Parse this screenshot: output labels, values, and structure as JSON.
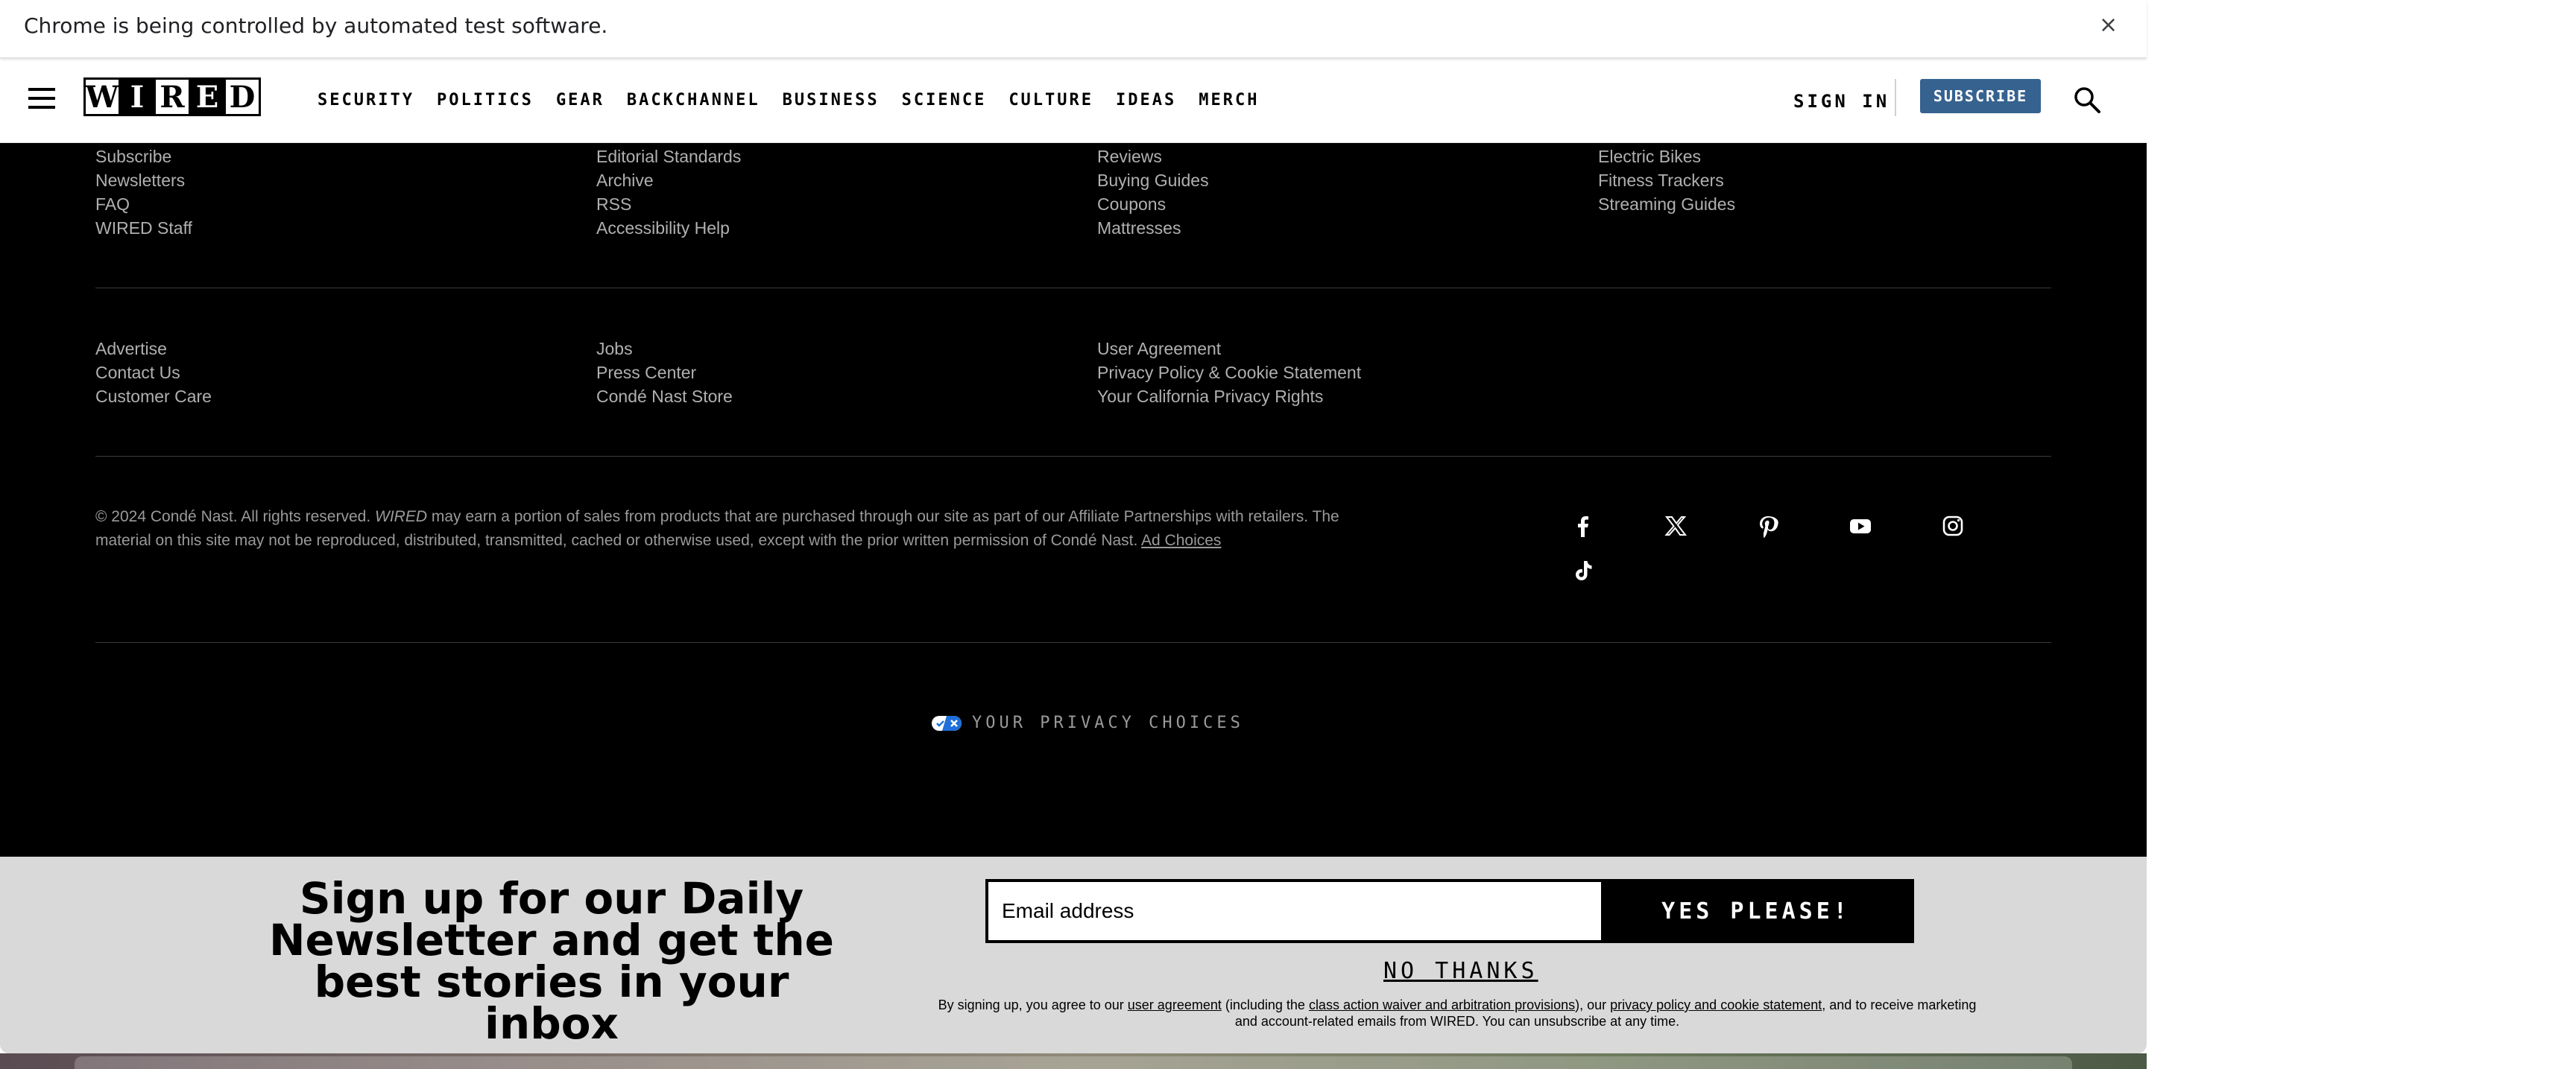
{
  "chrome_banner": {
    "text": "Chrome is being controlled by automated test software.",
    "close": "×"
  },
  "header": {
    "logo_letters": [
      "W",
      "I",
      "R",
      "E",
      "D"
    ],
    "nav": [
      "SECURITY",
      "POLITICS",
      "GEAR",
      "BACKCHANNEL",
      "BUSINESS",
      "SCIENCE",
      "CULTURE",
      "IDEAS",
      "MERCH"
    ],
    "sign_in": "SIGN IN",
    "subscribe": "SUBSCRIBE"
  },
  "footer": {
    "top_col1": [
      "Subscribe",
      "Newsletters",
      "FAQ",
      "WIRED Staff"
    ],
    "top_col2": [
      "Editorial Standards",
      "Archive",
      "RSS",
      "Accessibility Help"
    ],
    "top_col3": [
      "Reviews",
      "Buying Guides",
      "Coupons",
      "Mattresses"
    ],
    "top_col4": [
      "Electric Bikes",
      "Fitness Trackers",
      "Streaming Guides"
    ],
    "mid_col1": [
      "Advertise",
      "Contact Us",
      "Customer Care"
    ],
    "mid_col2": [
      "Jobs",
      "Press Center",
      "Condé Nast Store"
    ],
    "mid_col3": [
      "User Agreement",
      "Privacy Policy & Cookie Statement",
      "Your California Privacy Rights"
    ],
    "legal_prefix": "© 2024 Condé Nast. All rights reserved. ",
    "legal_brand": "WIRED",
    "legal_body": " may earn a portion of sales from products that are purchased through our site as part of our Affiliate Partnerships with retailers. The material on this site may not be reproduced, distributed, transmitted, cached or otherwise used, except with the prior written permission of Condé Nast. ",
    "ad_choices": "Ad Choices",
    "social_icons": [
      "facebook-icon",
      "x-icon",
      "pinterest-icon",
      "youtube-icon",
      "instagram-icon",
      "tiktok-icon"
    ],
    "privacy_choices": "YOUR PRIVACY CHOICES"
  },
  "newsletter": {
    "heading": "Sign up for our Daily Newsletter and get the best stories in your inbox",
    "email_placeholder": "Email address",
    "submit": "YES PLEASE!",
    "no_thanks": "NO THANKS",
    "disclaimer_1": "By signing up, you agree to our ",
    "link_user_agreement": "user agreement",
    "disclaimer_2": " (including the ",
    "link_class_action": "class action waiver and arbitration provisions",
    "disclaimer_3": "), our ",
    "link_privacy": "privacy policy and cookie statement",
    "disclaimer_4": ", and to receive marketing and account-related emails from WIRED. You can unsubscribe at any time."
  },
  "colors": {
    "subscribe_bg": "#36628f",
    "footer_bg": "#000000",
    "newsletter_bg": "#d9d9d9"
  }
}
